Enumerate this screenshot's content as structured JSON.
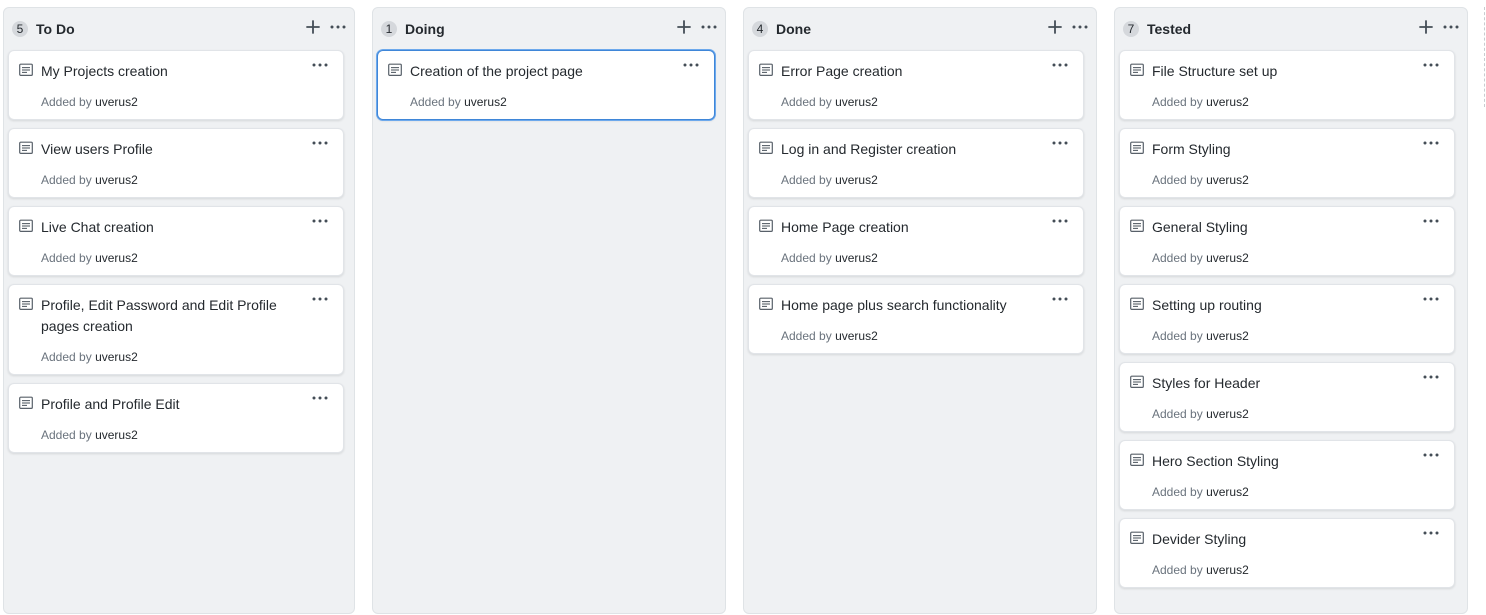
{
  "board": {
    "columns": [
      {
        "count": "5",
        "title": "To Do",
        "cards": [
          {
            "title": "My Projects creation",
            "added_by_prefix": "Added by",
            "user": "uverus2"
          },
          {
            "title": "View users Profile",
            "added_by_prefix": "Added by",
            "user": "uverus2"
          },
          {
            "title": "Live Chat creation",
            "added_by_prefix": "Added by",
            "user": "uverus2"
          },
          {
            "title": "Profile, Edit Password and Edit Profile pages creation",
            "added_by_prefix": "Added by",
            "user": "uverus2"
          },
          {
            "title": "Profile and Profile Edit",
            "added_by_prefix": "Added by",
            "user": "uverus2"
          }
        ]
      },
      {
        "count": "1",
        "title": "Doing",
        "cards": [
          {
            "title": "Creation of the project page",
            "added_by_prefix": "Added by",
            "user": "uverus2",
            "selected": true
          }
        ]
      },
      {
        "count": "4",
        "title": "Done",
        "cards": [
          {
            "title": "Error Page creation",
            "added_by_prefix": "Added by",
            "user": "uverus2"
          },
          {
            "title": "Log in and Register creation",
            "added_by_prefix": "Added by",
            "user": "uverus2"
          },
          {
            "title": "Home Page creation",
            "added_by_prefix": "Added by",
            "user": "uverus2"
          },
          {
            "title": "Home page plus search functionality",
            "added_by_prefix": "Added by",
            "user": "uverus2"
          }
        ]
      },
      {
        "count": "7",
        "title": "Tested",
        "cards": [
          {
            "title": "File Structure set up",
            "added_by_prefix": "Added by",
            "user": "uverus2"
          },
          {
            "title": "Form Styling",
            "added_by_prefix": "Added by",
            "user": "uverus2"
          },
          {
            "title": "General Styling",
            "added_by_prefix": "Added by",
            "user": "uverus2"
          },
          {
            "title": "Setting up routing",
            "added_by_prefix": "Added by",
            "user": "uverus2"
          },
          {
            "title": "Styles for Header",
            "added_by_prefix": "Added by",
            "user": "uverus2"
          },
          {
            "title": "Hero Section Styling",
            "added_by_prefix": "Added by",
            "user": "uverus2"
          },
          {
            "title": "Devider Styling",
            "added_by_prefix": "Added by",
            "user": "uverus2"
          }
        ]
      }
    ]
  },
  "icons": {
    "add": "plus-icon",
    "more": "kebab-horizontal-icon",
    "card_type": "note-icon"
  },
  "colors": {
    "column_bg": "#eff1f3",
    "card_border": "#e1e4e8",
    "selected_border": "#3f86d8",
    "meta_text": "#6a737d"
  }
}
